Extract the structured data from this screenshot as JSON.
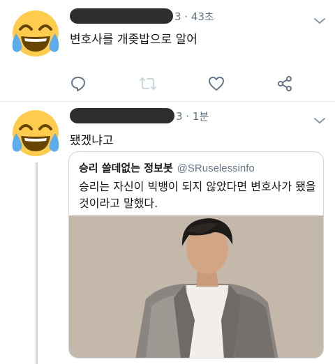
{
  "tweets": [
    {
      "author_redacted": true,
      "time_suffix": "3 · 43초",
      "text": "변호사를 개좆밥으로 알어",
      "avatar_icon": "face-with-tears-of-joy-emoji",
      "actions": [
        "reply",
        "retweet",
        "like",
        "share"
      ]
    },
    {
      "author_redacted": true,
      "time_suffix": "3 · 1분",
      "text": "됐겠냐고",
      "avatar_icon": "face-with-tears-of-joy-emoji",
      "quoted_tweet": {
        "name": "승리 쓸데없는 정보봇",
        "handle": "@SRuselessinfo",
        "text": "승리는 자신이 빅뱅이 되지 않았다면 변호사가 됐을 것이라고 말했다."
      }
    }
  ],
  "colors": {
    "accent": "#1da1f2",
    "muted": "#657786",
    "divider": "#e6ecf0",
    "redaction": "#2e2e2e",
    "emoji_face": "#ffcc4d",
    "emoji_tears": "#5dadec"
  }
}
